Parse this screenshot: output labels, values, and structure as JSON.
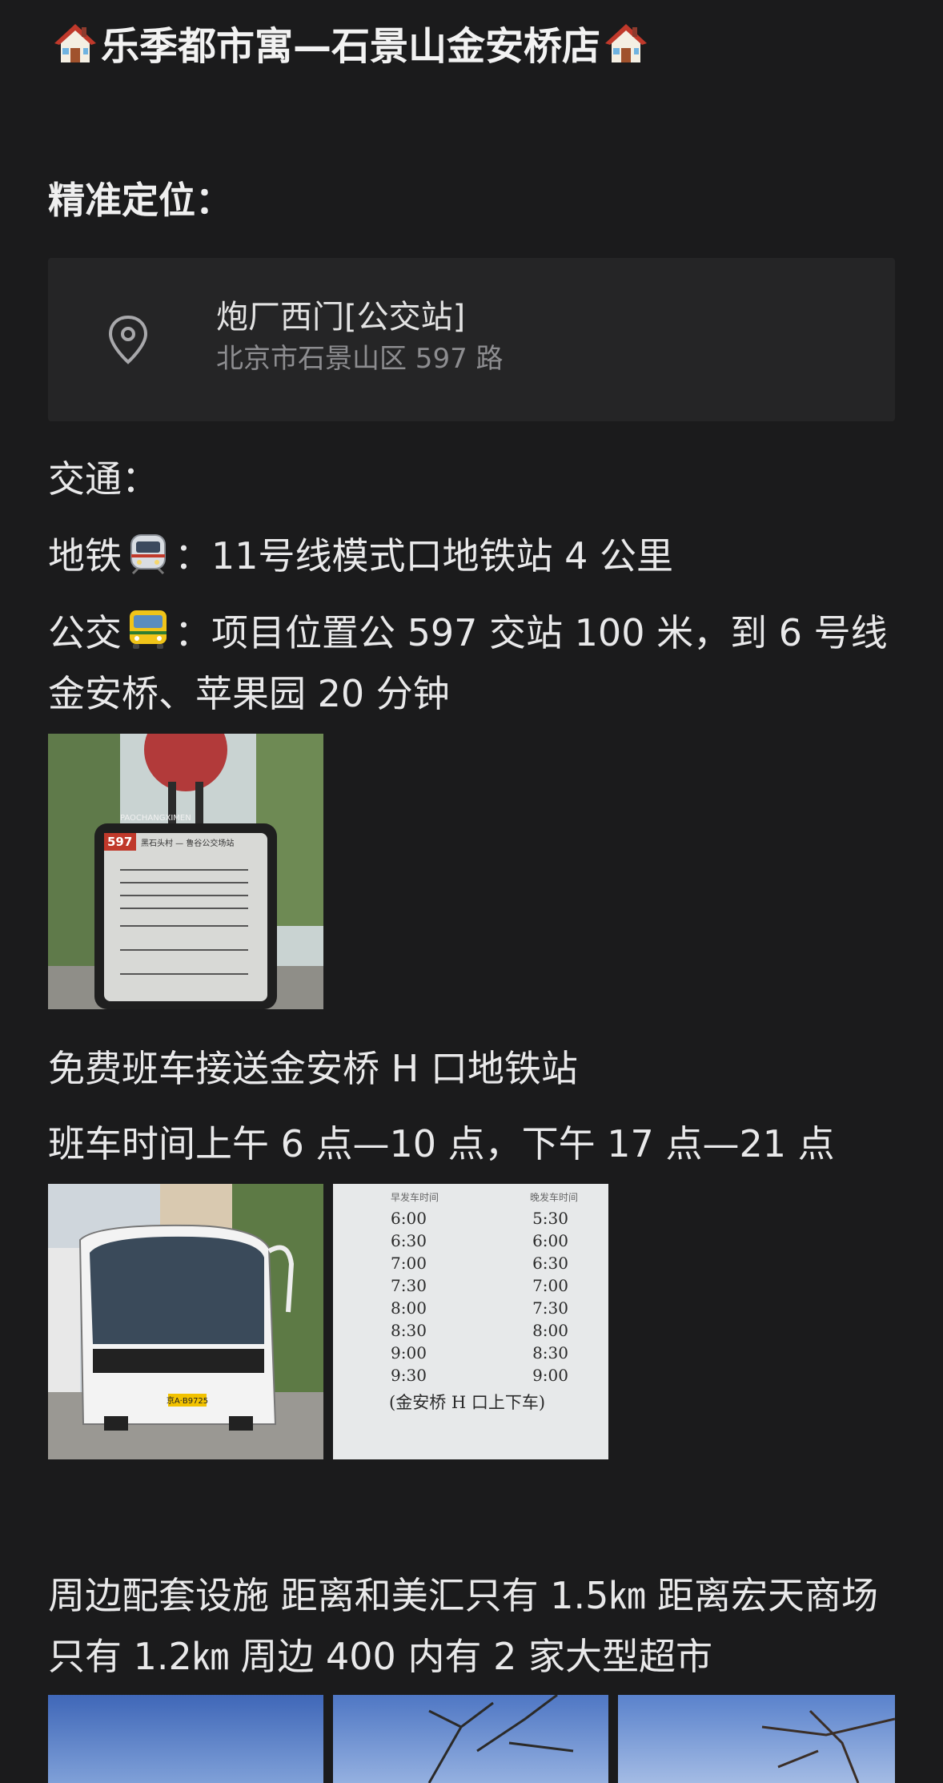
{
  "header": {
    "title": "乐季都市寓—石景山金安桥店",
    "icon": "house-emoji"
  },
  "location": {
    "heading": "精准定位：",
    "place_name": "炮厂西门[公交站]",
    "address": "北京市石景山区 597 路",
    "icon": "location-pin-icon"
  },
  "transport": {
    "heading": "交通：",
    "subway_prefix": "地铁",
    "subway_text": "：11号线模式口地铁站 4 公里",
    "bus_prefix": "公交",
    "bus_text": "：项目位置公 597 交站 100 米，到 6 号线金安桥、苹果园 20 分钟",
    "shuttle_line": "免费班车接送金安桥 H 口地铁站",
    "shuttle_time": "班车时间上午 6 点—10 点，下午 17 点—21 点"
  },
  "images": {
    "bus_stop": {
      "route": "597",
      "header": "PAOCHANGXIMEN",
      "board_title": "黑石头村 — 鲁谷公交场站"
    },
    "shuttle_plate": "京A·B9725",
    "timetable": {
      "col_left": "早发车时间",
      "col_right": "晚发车时间",
      "rows": [
        [
          "6:00",
          "5:30"
        ],
        [
          "6:30",
          "6:00"
        ],
        [
          "7:00",
          "6:30"
        ],
        [
          "7:30",
          "7:00"
        ],
        [
          "8:00",
          "7:30"
        ],
        [
          "8:30",
          "8:00"
        ],
        [
          "9:00",
          "8:30"
        ],
        [
          "9:30",
          "9:00"
        ]
      ],
      "note": "(金安桥 H 口上下车)"
    }
  },
  "surroundings": {
    "text": "周边配套设施 距离和美汇只有 1.5㎞ 距离宏天商场只有 1.2㎞ 周边 400 内有 2 家大型超市"
  },
  "colors": {
    "background": "#1b1b1c",
    "card": "#252526",
    "text": "#e9e9ea",
    "muted": "#8d8d90"
  }
}
